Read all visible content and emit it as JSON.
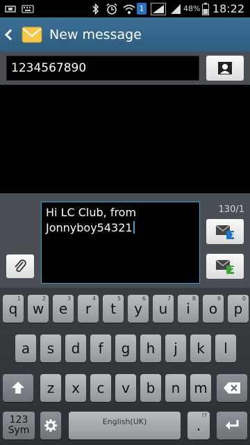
{
  "status_bar": {
    "time": "18:22",
    "battery_percent": "48%",
    "notification_count": "1",
    "icons": [
      "usb-icon",
      "keyboard-icon",
      "bluetooth-icon",
      "alarm-icon",
      "wifi-icon",
      "notification-badge-icon",
      "signal-icon",
      "battery-icon"
    ]
  },
  "header": {
    "title": "New message",
    "icons": [
      "back-chevron-icon",
      "message-app-icon"
    ]
  },
  "recipient": {
    "value": "1234567890",
    "contact_icon": "contact-person-icon"
  },
  "compose": {
    "message_text": "Hi LC Club, from\nJonnyboy54321",
    "char_counter": "130/1",
    "attach_icon": "paperclip-icon",
    "send_sim1_label": "1",
    "send_sim2_label": "2"
  },
  "keyboard": {
    "rows": [
      [
        {
          "k": "q",
          "h": "1"
        },
        {
          "k": "w",
          "h": "2"
        },
        {
          "k": "e",
          "h": "3"
        },
        {
          "k": "r",
          "h": "4"
        },
        {
          "k": "t",
          "h": "5"
        },
        {
          "k": "y",
          "h": "6"
        },
        {
          "k": "u",
          "h": "7"
        },
        {
          "k": "i",
          "h": "8"
        },
        {
          "k": "o",
          "h": "9"
        },
        {
          "k": "p",
          "h": "0"
        }
      ],
      [
        {
          "k": "a",
          "h": ""
        },
        {
          "k": "s",
          "h": ""
        },
        {
          "k": "d",
          "h": ""
        },
        {
          "k": "f",
          "h": ""
        },
        {
          "k": "g",
          "h": ""
        },
        {
          "k": "h",
          "h": ""
        },
        {
          "k": "j",
          "h": ""
        },
        {
          "k": "k",
          "h": ""
        },
        {
          "k": "l",
          "h": ""
        }
      ],
      [
        {
          "k": "z",
          "h": ""
        },
        {
          "k": "x",
          "h": ""
        },
        {
          "k": "c",
          "h": ""
        },
        {
          "k": "v",
          "h": ""
        },
        {
          "k": "b",
          "h": ""
        },
        {
          "k": "n",
          "h": ""
        },
        {
          "k": "m",
          "h": ""
        }
      ]
    ],
    "sym_label": "123\nSym",
    "space_label": "English(UK)",
    "period_label": ".",
    "period_hint": "!?",
    "icons": [
      "shift-icon",
      "backspace-icon",
      "settings-gear-icon",
      "enter-icon"
    ]
  }
}
